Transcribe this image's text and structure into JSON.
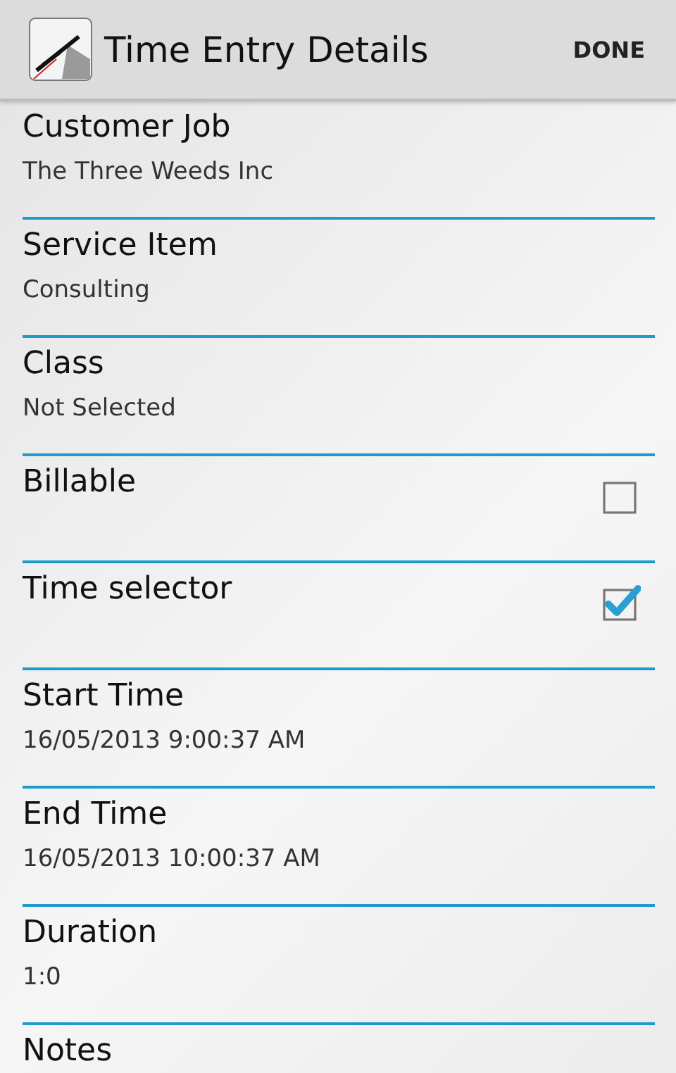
{
  "action_bar": {
    "title": "Time Entry Details",
    "action": "DONE"
  },
  "fields": [
    {
      "kind": "text",
      "label": "Customer Job",
      "value": "The Three Weeds Inc"
    },
    {
      "kind": "text",
      "label": "Service Item",
      "value": "Consulting"
    },
    {
      "kind": "text",
      "label": "Class",
      "value": "Not Selected"
    },
    {
      "kind": "checkbox",
      "label": "Billable",
      "checked": false
    },
    {
      "kind": "checkbox",
      "label": "Time selector",
      "checked": true
    },
    {
      "kind": "text",
      "label": "Start Time",
      "value": "16/05/2013 9:00:37 AM"
    },
    {
      "kind": "text",
      "label": "End Time",
      "value": "16/05/2013 10:00:37 AM"
    },
    {
      "kind": "text",
      "label": "Duration",
      "value": "1:0"
    },
    {
      "kind": "text",
      "label": "Notes"
    }
  ]
}
